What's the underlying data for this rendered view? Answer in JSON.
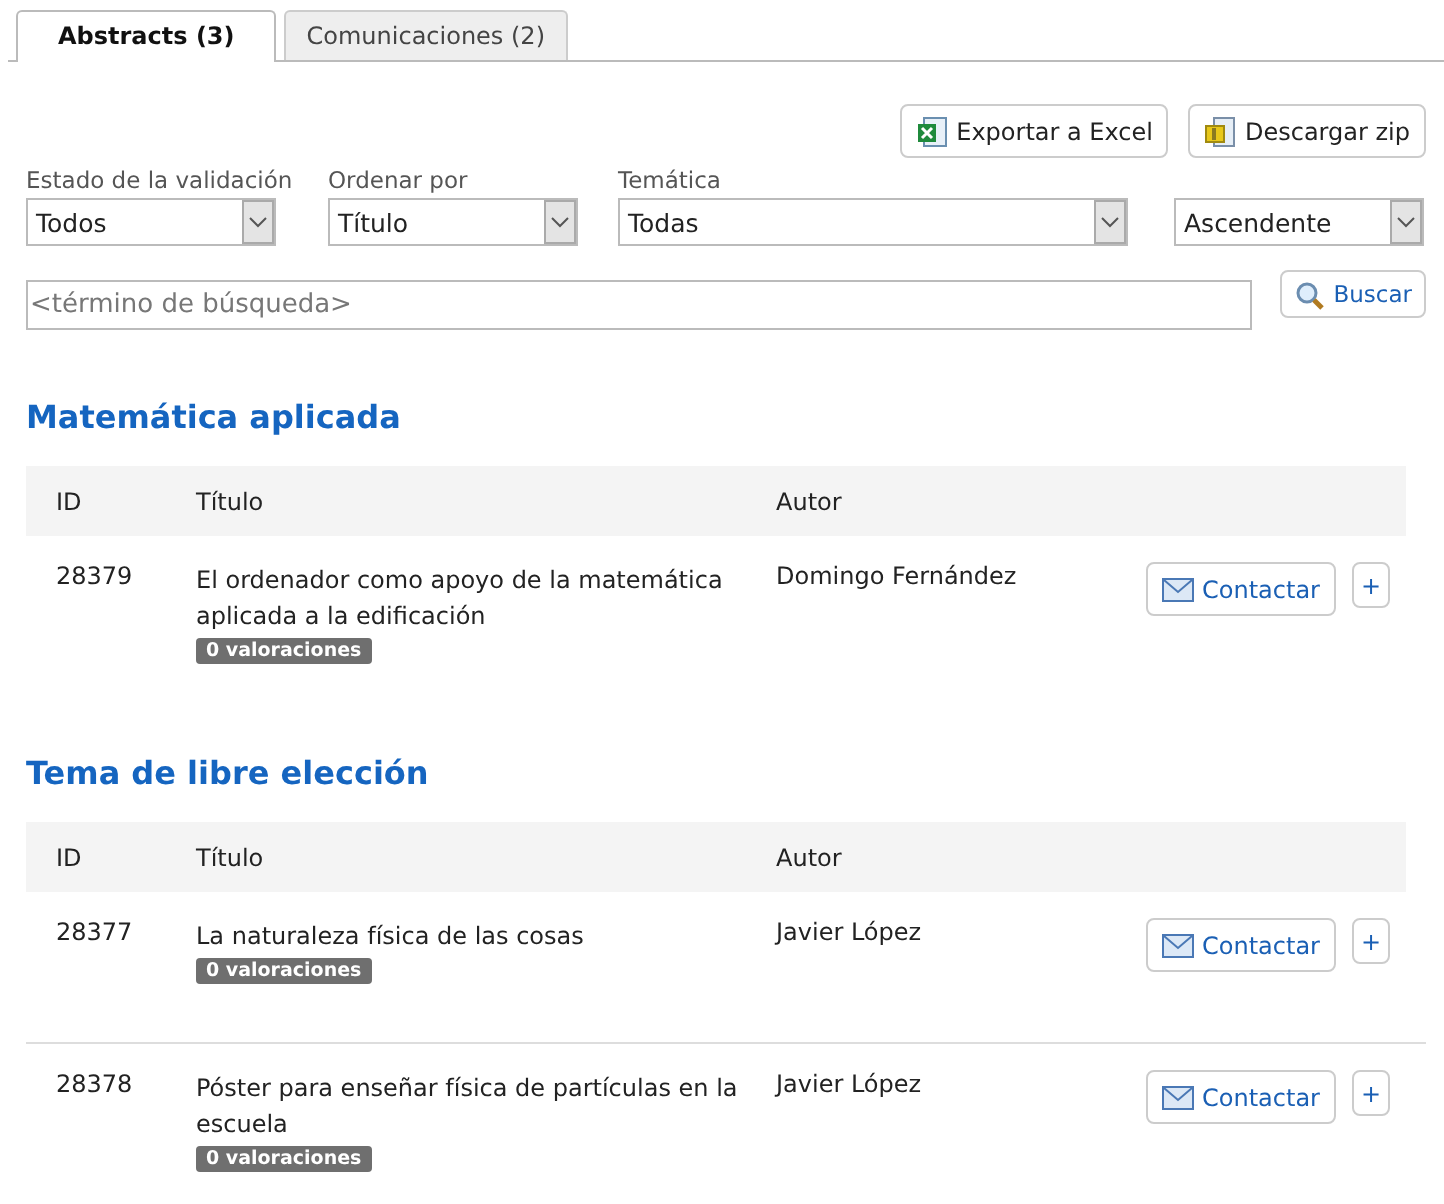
{
  "tabs": [
    {
      "label": "Abstracts (3)",
      "selected": true
    },
    {
      "label": "Comunicaciones (2)",
      "selected": false
    }
  ],
  "actions": [
    {
      "kind": "excel",
      "label": "Exportar a Excel"
    },
    {
      "kind": "zip",
      "label": "Descargar zip"
    }
  ],
  "filters": [
    {
      "label": "Estado de la validación",
      "value": "Todos"
    },
    {
      "label": "Ordenar por",
      "value": "Título"
    },
    {
      "label": "Temática",
      "value": "Todas"
    },
    {
      "value": "Ascendente"
    }
  ],
  "search": {
    "placeholder": "<término de búsqueda>",
    "button": "Buscar"
  },
  "sections": [
    {
      "title": "Matemática aplicada",
      "columns": [
        "ID",
        "Título",
        "Autor"
      ],
      "rows": [
        {
          "id": "28379",
          "title": "El ordenador como apoyo de la matemática aplicada a la edificación",
          "badge": "0 valoraciones",
          "author": "Domingo Fernández",
          "contact": "Contactar",
          "more": "+"
        }
      ]
    },
    {
      "title": "Tema de libre elección",
      "columns": [
        "ID",
        "Título",
        "Autor"
      ],
      "rows": [
        {
          "id": "28377",
          "title": "La naturaleza física de las cosas",
          "badge": "0 valoraciones",
          "author": "Javier López",
          "contact": "Contactar",
          "more": "+"
        },
        {
          "id": "28378",
          "title": "Póster para enseñar física de partículas en la escuela",
          "badge": "0 valoraciones",
          "author": "Javier López",
          "contact": "Contactar",
          "more": "+"
        }
      ]
    }
  ]
}
